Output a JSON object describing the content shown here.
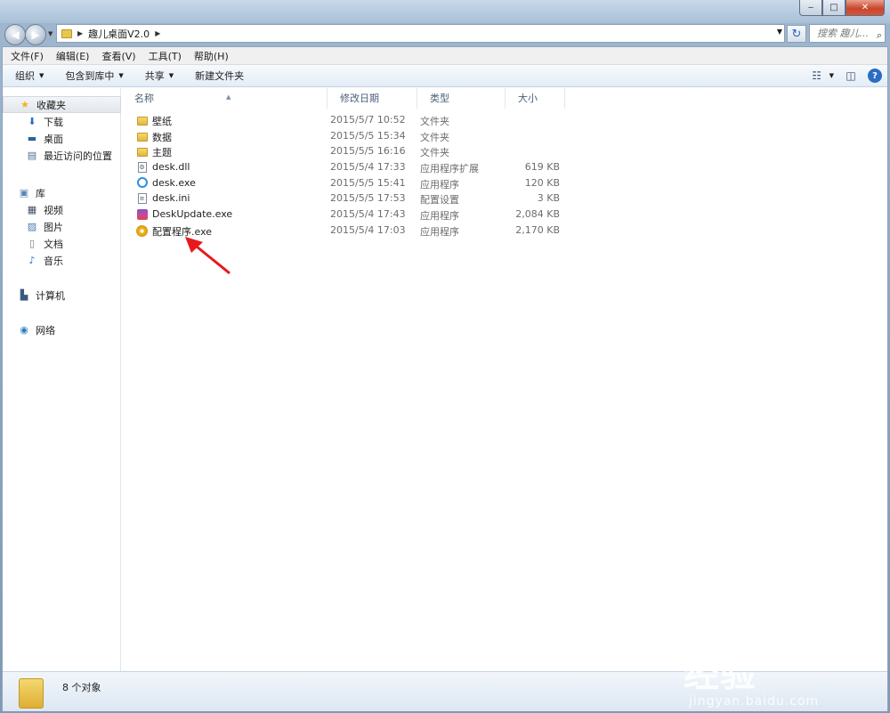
{
  "window": {
    "minimize_glyph": "‒",
    "maximize_glyph": "□",
    "close_glyph": "✕"
  },
  "address": {
    "path": "趣儿桌面V2.0",
    "search_placeholder": "搜索 趣儿..."
  },
  "menu": [
    "文件(F)",
    "编辑(E)",
    "查看(V)",
    "工具(T)",
    "帮助(H)"
  ],
  "toolbar": {
    "organize": "组织",
    "include_in_library": "包含到库中",
    "share": "共享",
    "new_folder": "新建文件夹",
    "view_icon": "view-menu-icon",
    "preview_icon": "preview-pane-icon",
    "help_icon": "help-icon",
    "help_label": "?"
  },
  "navpane": {
    "favorites": "收藏夹",
    "favorites_items": [
      "下载",
      "桌面",
      "最近访问的位置"
    ],
    "libraries": "库",
    "library_items": [
      "视频",
      "图片",
      "文档",
      "音乐"
    ],
    "computer": "计算机",
    "network": "网络"
  },
  "columns": {
    "name": "名称",
    "date": "修改日期",
    "type": "类型",
    "size": "大小"
  },
  "files": [
    {
      "name": "壁纸",
      "date": "2015/5/7 10:52",
      "type": "文件夹",
      "size": "",
      "icon": "folder-icon"
    },
    {
      "name": "数据",
      "date": "2015/5/5 15:34",
      "type": "文件夹",
      "size": "",
      "icon": "folder-icon"
    },
    {
      "name": "主题",
      "date": "2015/5/5 16:16",
      "type": "文件夹",
      "size": "",
      "icon": "folder-icon"
    },
    {
      "name": "desk.dll",
      "date": "2015/5/4 17:33",
      "type": "应用程序扩展",
      "size": "619 KB",
      "icon": "dll-icon"
    },
    {
      "name": "desk.exe",
      "date": "2015/5/5 15:41",
      "type": "应用程序",
      "size": "120 KB",
      "icon": "app-icon"
    },
    {
      "name": "desk.ini",
      "date": "2015/5/5 17:53",
      "type": "配置设置",
      "size": "3 KB",
      "icon": "ini-icon"
    },
    {
      "name": "DeskUpdate.exe",
      "date": "2015/5/4 17:43",
      "type": "应用程序",
      "size": "2,084 KB",
      "icon": "update-icon"
    },
    {
      "name": "配置程序.exe",
      "date": "2015/5/4 17:03",
      "type": "应用程序",
      "size": "2,170 KB",
      "icon": "gear-icon"
    }
  ],
  "status": {
    "count_text": "8 个对象"
  },
  "watermark": {
    "logo": "Bai du 经验",
    "url": "jingyan.baidu.com"
  },
  "colors": {
    "annotation_arrow": "#e8191b",
    "accent": "#2b6cc4"
  }
}
